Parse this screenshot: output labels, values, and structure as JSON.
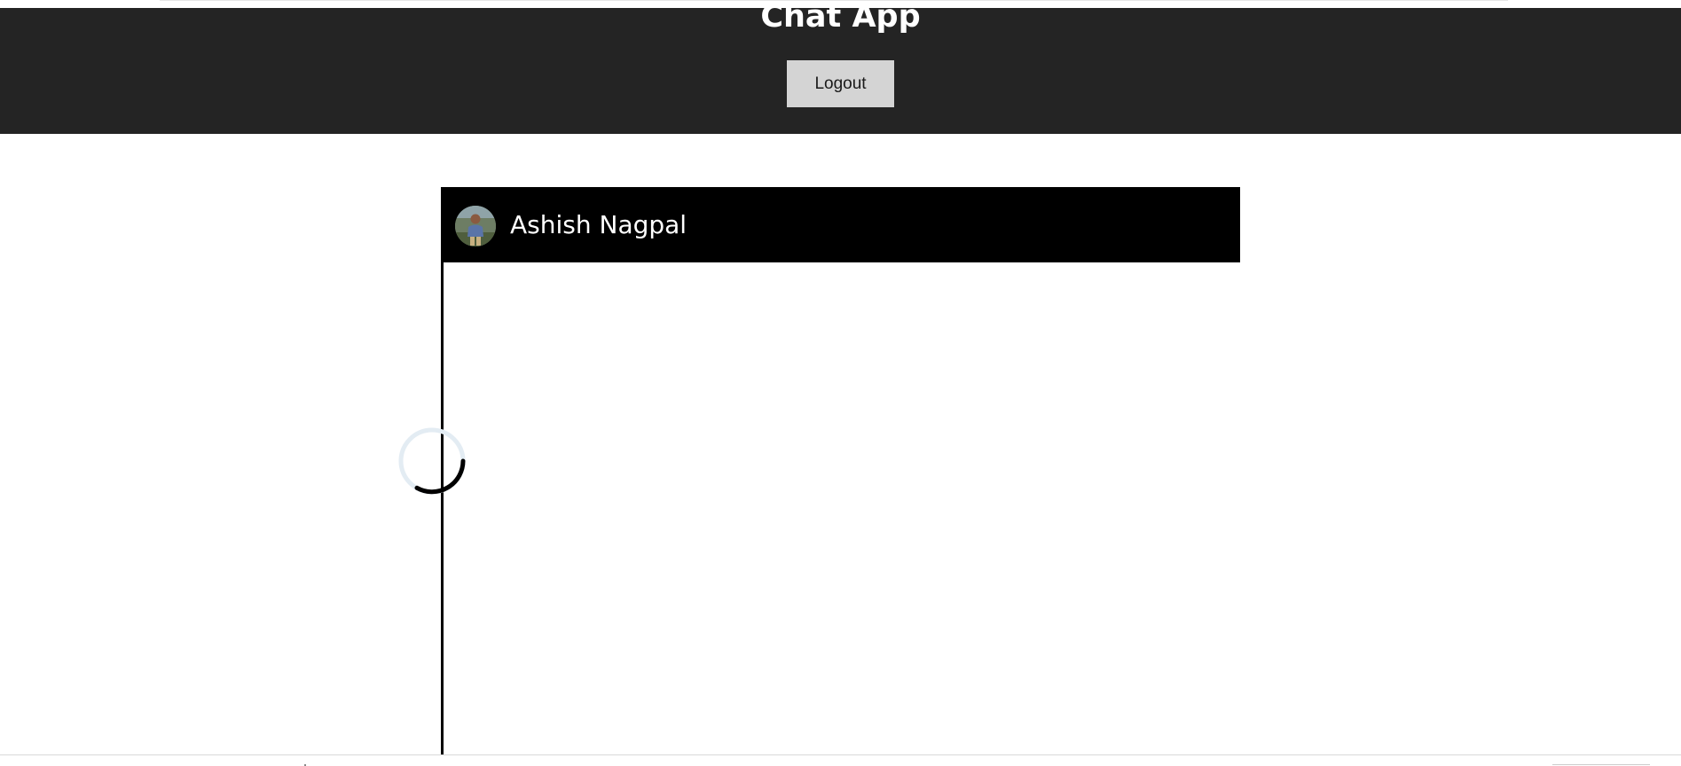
{
  "header": {
    "title": "Chat App",
    "logout_label": "Logout",
    "background": "#242424"
  },
  "chat": {
    "contact_name": "Ashish Nagpal",
    "avatar_icon": "user-avatar-photo",
    "header_background": "#000000",
    "state": "loading",
    "spinner_icon": "loading-spinner-icon"
  }
}
